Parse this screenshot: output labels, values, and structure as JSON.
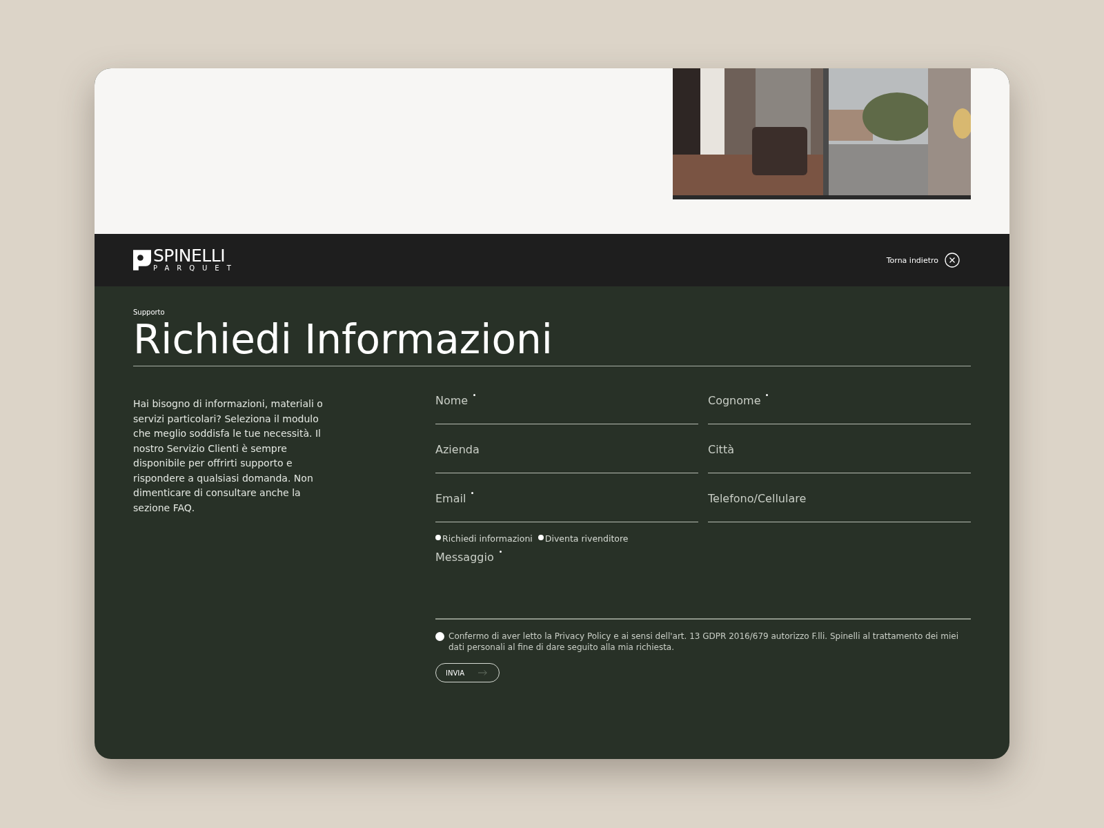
{
  "header": {
    "brand": "SPINELLI",
    "brand_sub": "PARQUET",
    "back_link": "Torna indietro"
  },
  "eyebrow": "Supporto",
  "title": "Richiedi Informazioni",
  "intro": "Hai bisogno di informazioni, materiali o servizi particolari? Seleziona il modulo che meglio soddisfa le tue necessità. Il nostro Servizio Clienti è sempre disponibile per offrirti supporto e rispondere a qualsiasi domanda. Non dimenticare di consultare anche la sezione FAQ.",
  "fields": [
    {
      "label": "Nome",
      "required": true
    },
    {
      "label": "Cognome",
      "required": true
    },
    {
      "label": "Azienda",
      "required": false
    },
    {
      "label": "Città",
      "required": false
    },
    {
      "label": "Email",
      "required": true
    },
    {
      "label": "Telefono/Cellulare",
      "required": false
    }
  ],
  "request_type": [
    {
      "label": "Richiedi informazioni",
      "selected": false
    },
    {
      "label": "Diventa rivenditore",
      "selected": false
    }
  ],
  "message": {
    "label": "Messaggio",
    "required": true
  },
  "consent": {
    "text": "Confermo di aver letto la Privacy Policy e ai sensi dell'art. 13 GDPR 2016/679 autorizzo F.lli. Spinelli al trattamento dei miei dati personali al fine di dare seguito alla mia richiesta.",
    "checked": false
  },
  "submit": "INVIA"
}
